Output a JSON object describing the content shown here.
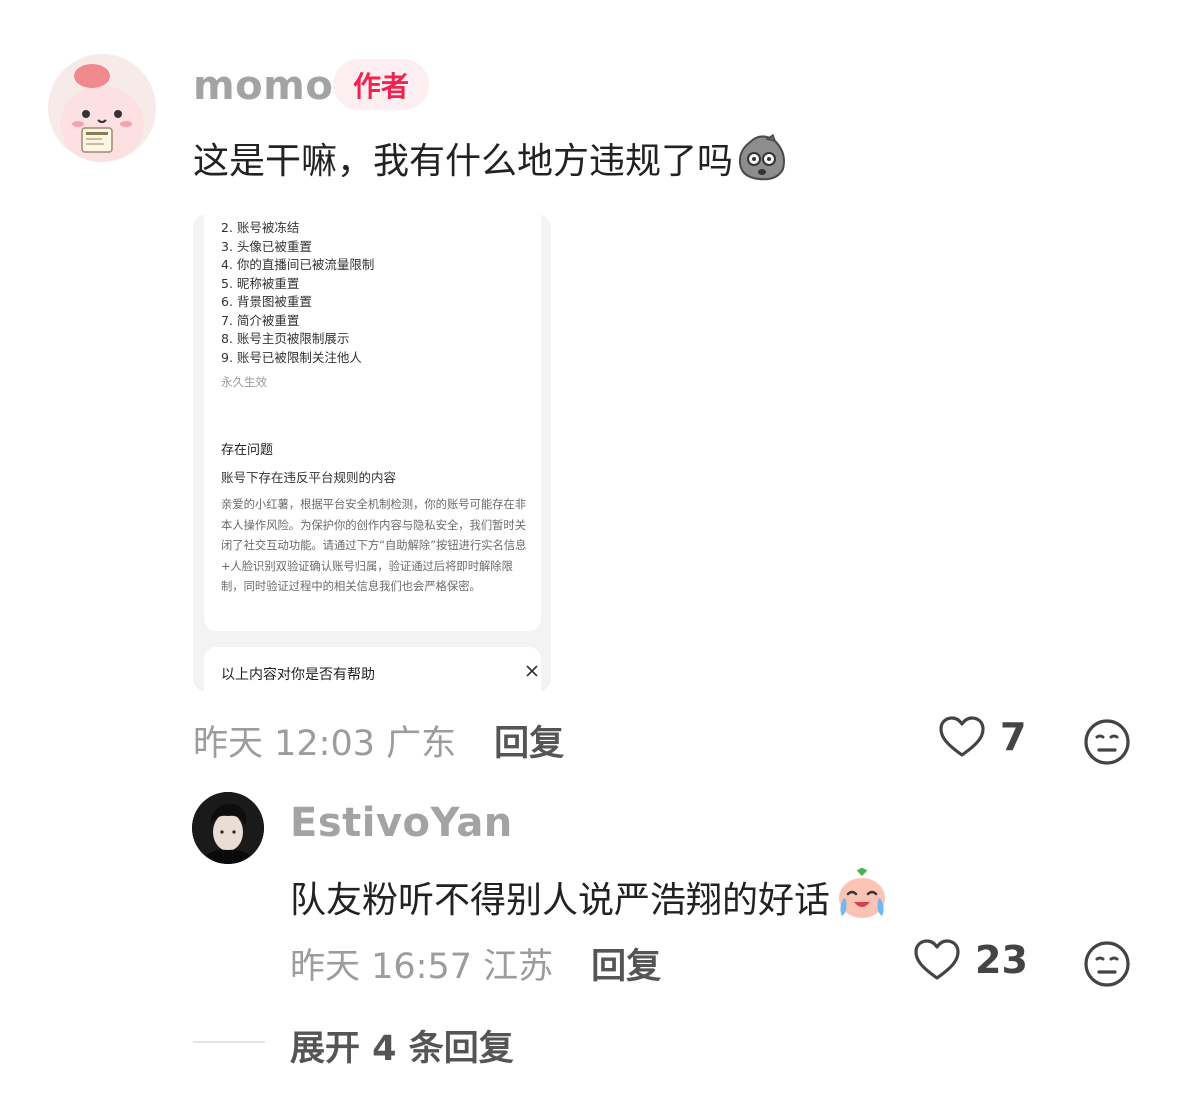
{
  "comment": {
    "username": "momo",
    "badge": "作者",
    "text": "这是干嘛，我有什么地方违规了吗",
    "screenshot": {
      "penalties": [
        "2. 账号被冻结",
        "3. 头像已被重置",
        "4. 你的直播间已被流量限制",
        "5. 昵称被重置",
        "6. 背景图被重置",
        "7. 简介被重置",
        "8. 账号主页被限制展示",
        "9. 账号已被限制关注他人"
      ],
      "effect_note": "永久生效",
      "issue_heading": "存在问题",
      "issue_title": "账号下存在违反平台规则的内容",
      "issue_body": "亲爱的小红薯，根据平台安全机制检测，你的账号可能存在非本人操作风险。为保护你的创作内容与隐私安全，我们暂时关闭了社交互动功能。请通过下方“自助解除”按钮进行实名信息+人脸识别双验证确认账号归属，验证通过后将即时解除限制，同时验证过程中的相关信息我们也会严格保密。",
      "feedback_question": "以上内容对你是否有帮助"
    },
    "time_location": "昨天 12:03 广东",
    "reply_label": "回复",
    "likes": "7"
  },
  "reply": {
    "username": "EstivoYan",
    "text": "队友粉听不得别人说严浩翔的好话",
    "time_location": "昨天 16:57 江苏",
    "reply_label": "回复",
    "likes": "23"
  },
  "expand_label": "展开 4 条回复",
  "colors": {
    "author_badge_text": "#f0244e",
    "author_badge_bg": "#fdeff1",
    "meta_gray": "#9c9c9c",
    "username_gray": "#a3a3a3"
  }
}
